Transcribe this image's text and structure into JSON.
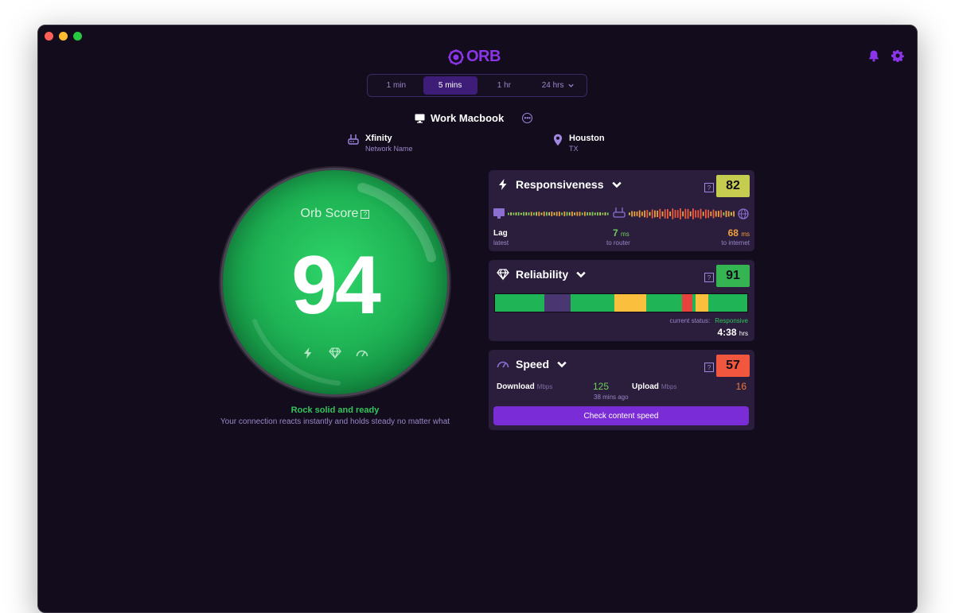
{
  "app": {
    "logo_text": "ORB"
  },
  "time_range": {
    "options": [
      {
        "label": "1 min"
      },
      {
        "label": "5 mins",
        "active": true
      },
      {
        "label": "1 hr"
      },
      {
        "label": "24 hrs"
      }
    ]
  },
  "device": {
    "name": "Work Macbook"
  },
  "network": {
    "name": "Xfinity",
    "sub": "Network Name"
  },
  "location": {
    "city": "Houston",
    "state": "TX"
  },
  "orb": {
    "label": "Orb Score",
    "help": "?",
    "score": "94",
    "color": "#1fb455",
    "icons": [
      "lightning-icon",
      "diamond-icon",
      "speedometer-icon"
    ]
  },
  "status": {
    "title": "Rock solid and ready",
    "subtitle": "Your connection reacts instantly and holds steady no matter what"
  },
  "responsiveness": {
    "title": "Responsiveness",
    "score": "82",
    "score_color": "#c5cc4f",
    "lag_label": "Lag",
    "lag_sub": "latest",
    "router_value": "7",
    "router_unit": "ms",
    "router_sub": "to router",
    "internet_value": "68",
    "internet_unit": "ms",
    "internet_sub": "to internet"
  },
  "reliability": {
    "title": "Reliability",
    "score": "91",
    "score_color": "#35b552",
    "status_label": "current status:",
    "status_value": "Responsive",
    "uptime": "4:38",
    "uptime_unit": "hrs",
    "segments": [
      {
        "color": "#1fb455",
        "share": 19
      },
      {
        "color": "#4a3670",
        "share": 10
      },
      {
        "color": "#1fb455",
        "share": 17
      },
      {
        "color": "#fbbf3e",
        "share": 12
      },
      {
        "color": "#1fb455",
        "share": 14
      },
      {
        "color": "#e8423f",
        "share": 4
      },
      {
        "color": "#1fb455",
        "share": 1
      },
      {
        "color": "#fbbf3e",
        "share": 5
      },
      {
        "color": "#1fb455",
        "share": 15
      }
    ]
  },
  "speed": {
    "title": "Speed",
    "score": "57",
    "score_color": "#f0573e",
    "download_label": "Download",
    "download_unit": "Mbps",
    "download_value": "125",
    "upload_label": "Upload",
    "upload_unit": "Mbps",
    "upload_value": "16",
    "updated": "38 mins ago",
    "button_label": "Check content speed"
  }
}
